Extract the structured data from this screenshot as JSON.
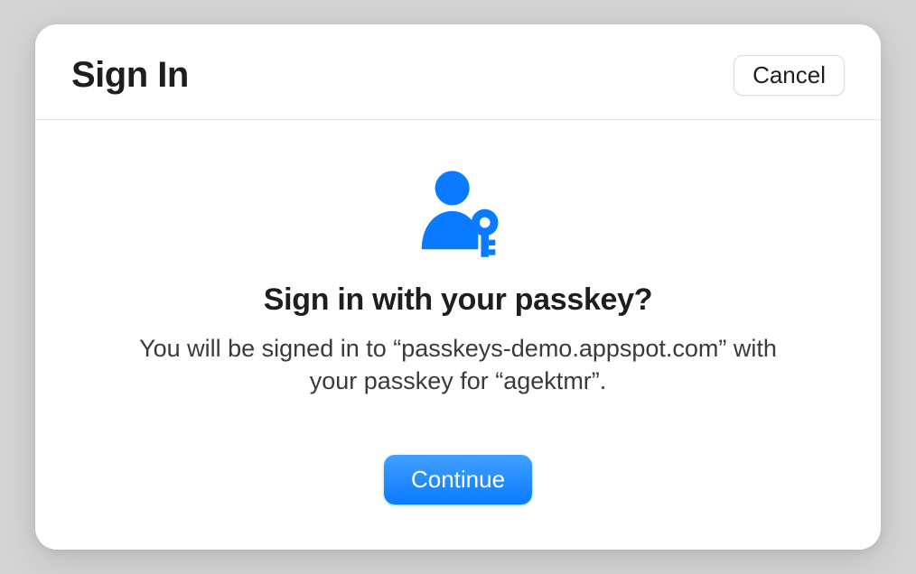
{
  "header": {
    "title": "Sign In",
    "cancel_label": "Cancel"
  },
  "body": {
    "icon": "passkey-user-key-icon",
    "title": "Sign in with your passkey?",
    "description": "You will be signed in to “passkeys-demo.appspot.com” with your passkey for “agektmr”.",
    "continue_label": "Continue"
  },
  "colors": {
    "accent": "#0a7aff",
    "background": "#d4d4d4",
    "dialog_bg": "#ffffff"
  }
}
